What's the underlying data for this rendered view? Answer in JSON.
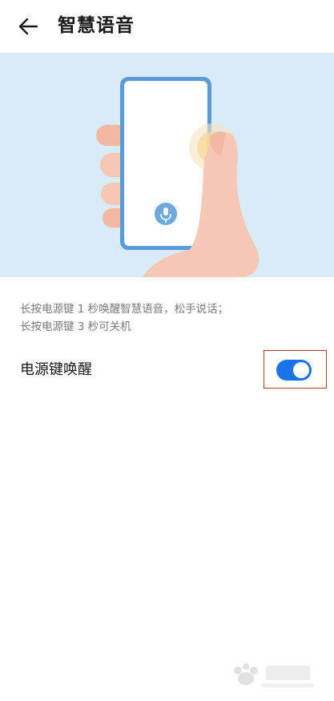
{
  "header": {
    "title": "智慧语音",
    "back_icon": "arrow-left-icon"
  },
  "hero": {
    "illustration": "phone-in-hand-illustration",
    "mic_icon": "microphone-icon",
    "colors": {
      "background": "#d8ebf7",
      "phone_frame": "#5b9bd5",
      "skin": "#f6c7b4",
      "mic_button": "#6fa8dc",
      "press_glow": "#f9d89a"
    }
  },
  "description": {
    "line1": "长按电源键 1 秒唤醒智慧语音，松手说话；",
    "line2": "长按电源键 3 秒可关机"
  },
  "setting": {
    "label": "电源键唤醒",
    "toggle_state": "on",
    "toggle_color": "#1a73e8",
    "highlight_color": "#c0392b"
  }
}
